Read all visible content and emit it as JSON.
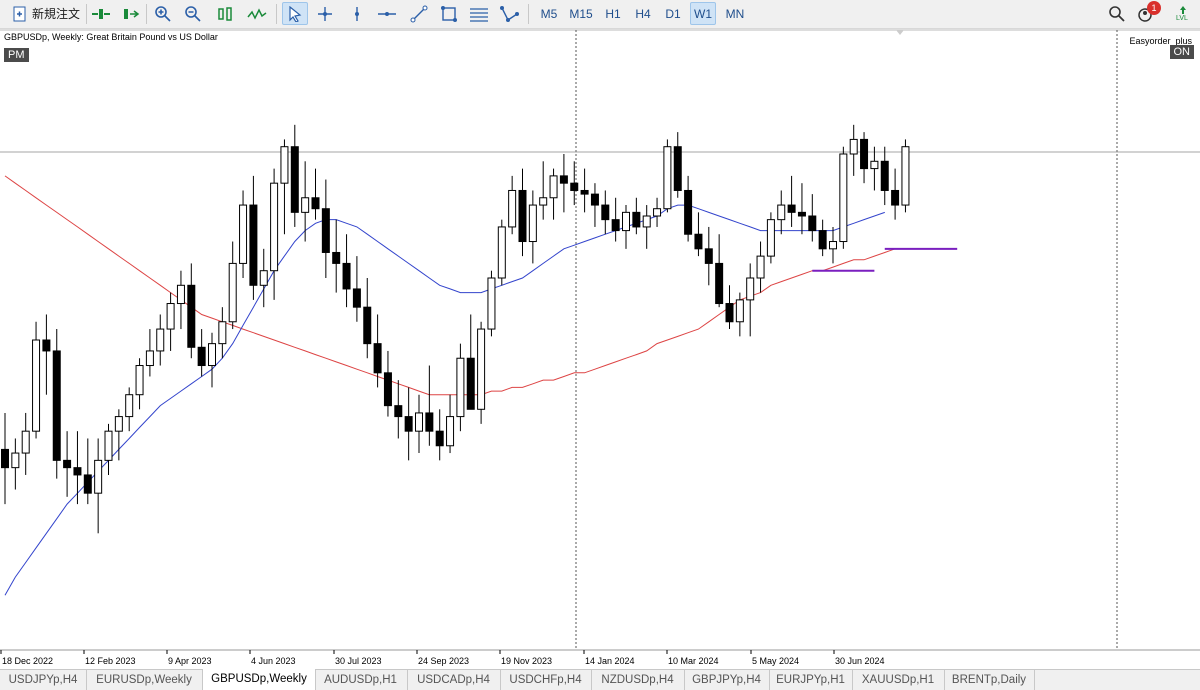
{
  "toolbar": {
    "new_order_label": "新規注文",
    "timeframes": [
      "M5",
      "M15",
      "H1",
      "H4",
      "D1",
      "W1",
      "MN"
    ],
    "active_timeframe": "W1",
    "notification_count": "1",
    "lvl_label": "LVL"
  },
  "chart": {
    "title": "GBPUSDp, Weekly:  Great Britain Pound vs US Dollar",
    "pm_badge": "PM",
    "ea_name": "Easyorder_plus",
    "ea_status": "ON",
    "x_labels": [
      "18 Dec 2022",
      "12 Feb 2023",
      "9 Apr 2023",
      "4 Jun 2023",
      "30 Jul 2023",
      "24 Sep 2023",
      "19 Nov 2023",
      "14 Jan 2024",
      "10 Mar 2024",
      "5 May 2024",
      "30 Jun 2024"
    ],
    "colors": {
      "bull": "#ffffff",
      "bear": "#000000",
      "ma_fast": "#3344cc",
      "ma_slow": "#dd4444",
      "hline": "#7a1fbf"
    },
    "candles": [
      {
        "o": -55,
        "h": -45,
        "l": -70,
        "c": -60
      },
      {
        "o": -60,
        "h": -52,
        "l": -66,
        "c": -56
      },
      {
        "o": -56,
        "h": -45,
        "l": -62,
        "c": -50
      },
      {
        "o": -50,
        "h": -20,
        "l": -52,
        "c": -25
      },
      {
        "o": -25,
        "h": -18,
        "l": -40,
        "c": -28
      },
      {
        "o": -28,
        "h": -22,
        "l": -63,
        "c": -58
      },
      {
        "o": -58,
        "h": -50,
        "l": -68,
        "c": -60
      },
      {
        "o": -60,
        "h": -50,
        "l": -70,
        "c": -62
      },
      {
        "o": -62,
        "h": -52,
        "l": -70,
        "c": -67
      },
      {
        "o": -67,
        "h": -52,
        "l": -78,
        "c": -58
      },
      {
        "o": -58,
        "h": -48,
        "l": -62,
        "c": -50
      },
      {
        "o": -50,
        "h": -44,
        "l": -58,
        "c": -46
      },
      {
        "o": -46,
        "h": -38,
        "l": -50,
        "c": -40
      },
      {
        "o": -40,
        "h": -30,
        "l": -44,
        "c": -32
      },
      {
        "o": -32,
        "h": -22,
        "l": -35,
        "c": -28
      },
      {
        "o": -28,
        "h": -18,
        "l": -32,
        "c": -22
      },
      {
        "o": -22,
        "h": -12,
        "l": -28,
        "c": -15
      },
      {
        "o": -15,
        "h": -6,
        "l": -22,
        "c": -10
      },
      {
        "o": -10,
        "h": -4,
        "l": -30,
        "c": -27
      },
      {
        "o": -27,
        "h": -22,
        "l": -35,
        "c": -32
      },
      {
        "o": -32,
        "h": -23,
        "l": -38,
        "c": -26
      },
      {
        "o": -26,
        "h": -16,
        "l": -30,
        "c": -20
      },
      {
        "o": -20,
        "h": 2,
        "l": -22,
        "c": -4
      },
      {
        "o": -4,
        "h": 16,
        "l": -8,
        "c": 12
      },
      {
        "o": 12,
        "h": 20,
        "l": -14,
        "c": -10
      },
      {
        "o": -10,
        "h": 0,
        "l": -16,
        "c": -6
      },
      {
        "o": -6,
        "h": 22,
        "l": -14,
        "c": 18
      },
      {
        "o": 18,
        "h": 30,
        "l": 4,
        "c": 28
      },
      {
        "o": 28,
        "h": 34,
        "l": 6,
        "c": 10
      },
      {
        "o": 10,
        "h": 24,
        "l": 2,
        "c": 14
      },
      {
        "o": 14,
        "h": 22,
        "l": 8,
        "c": 11
      },
      {
        "o": 11,
        "h": 19,
        "l": -8,
        "c": -1
      },
      {
        "o": -1,
        "h": 8,
        "l": -12,
        "c": -4
      },
      {
        "o": -4,
        "h": 4,
        "l": -16,
        "c": -11
      },
      {
        "o": -11,
        "h": -2,
        "l": -20,
        "c": -16
      },
      {
        "o": -16,
        "h": -8,
        "l": -30,
        "c": -26
      },
      {
        "o": -26,
        "h": -18,
        "l": -38,
        "c": -34
      },
      {
        "o": -34,
        "h": -28,
        "l": -46,
        "c": -43
      },
      {
        "o": -43,
        "h": -36,
        "l": -52,
        "c": -46
      },
      {
        "o": -46,
        "h": -38,
        "l": -58,
        "c": -50
      },
      {
        "o": -50,
        "h": -40,
        "l": -56,
        "c": -45
      },
      {
        "o": -45,
        "h": -32,
        "l": -54,
        "c": -50
      },
      {
        "o": -50,
        "h": -44,
        "l": -58,
        "c": -54
      },
      {
        "o": -54,
        "h": -40,
        "l": -56,
        "c": -46
      },
      {
        "o": -46,
        "h": -26,
        "l": -50,
        "c": -30
      },
      {
        "o": -30,
        "h": -18,
        "l": -38,
        "c": -44
      },
      {
        "o": -44,
        "h": -20,
        "l": -48,
        "c": -22
      },
      {
        "o": -22,
        "h": -6,
        "l": -24,
        "c": -8
      },
      {
        "o": -8,
        "h": 8,
        "l": -10,
        "c": 6
      },
      {
        "o": 6,
        "h": 20,
        "l": 4,
        "c": 16
      },
      {
        "o": 16,
        "h": 22,
        "l": -2,
        "c": 2
      },
      {
        "o": 2,
        "h": 16,
        "l": -4,
        "c": 12
      },
      {
        "o": 12,
        "h": 24,
        "l": 8,
        "c": 14
      },
      {
        "o": 14,
        "h": 22,
        "l": 8,
        "c": 20
      },
      {
        "o": 20,
        "h": 26,
        "l": 10,
        "c": 18
      },
      {
        "o": 18,
        "h": 24,
        "l": 12,
        "c": 16
      },
      {
        "o": 16,
        "h": 22,
        "l": 10,
        "c": 15
      },
      {
        "o": 15,
        "h": 18,
        "l": 6,
        "c": 12
      },
      {
        "o": 12,
        "h": 16,
        "l": 4,
        "c": 8
      },
      {
        "o": 8,
        "h": 14,
        "l": 2,
        "c": 5
      },
      {
        "o": 5,
        "h": 12,
        "l": 0,
        "c": 10
      },
      {
        "o": 10,
        "h": 14,
        "l": 4,
        "c": 6
      },
      {
        "o": 6,
        "h": 12,
        "l": 0,
        "c": 9
      },
      {
        "o": 9,
        "h": 14,
        "l": 6,
        "c": 11
      },
      {
        "o": 11,
        "h": 30,
        "l": 10,
        "c": 28
      },
      {
        "o": 28,
        "h": 32,
        "l": 14,
        "c": 16
      },
      {
        "o": 16,
        "h": 20,
        "l": 2,
        "c": 4
      },
      {
        "o": 4,
        "h": 10,
        "l": -2,
        "c": 0
      },
      {
        "o": 0,
        "h": 6,
        "l": -10,
        "c": -4
      },
      {
        "o": -4,
        "h": 4,
        "l": -16,
        "c": -15
      },
      {
        "o": -15,
        "h": -10,
        "l": -22,
        "c": -20
      },
      {
        "o": -20,
        "h": -12,
        "l": -24,
        "c": -14
      },
      {
        "o": -14,
        "h": -4,
        "l": -24,
        "c": -8
      },
      {
        "o": -8,
        "h": 2,
        "l": -12,
        "c": -2
      },
      {
        "o": -2,
        "h": 10,
        "l": -4,
        "c": 8
      },
      {
        "o": 8,
        "h": 16,
        "l": 4,
        "c": 12
      },
      {
        "o": 12,
        "h": 20,
        "l": 6,
        "c": 10
      },
      {
        "o": 10,
        "h": 18,
        "l": 4,
        "c": 9
      },
      {
        "o": 9,
        "h": 15,
        "l": 2,
        "c": 5
      },
      {
        "o": 5,
        "h": 8,
        "l": -2,
        "c": 0
      },
      {
        "o": 0,
        "h": 6,
        "l": -4,
        "c": 2
      },
      {
        "o": 2,
        "h": 28,
        "l": 0,
        "c": 26
      },
      {
        "o": 26,
        "h": 34,
        "l": 20,
        "c": 30
      },
      {
        "o": 30,
        "h": 32,
        "l": 18,
        "c": 22
      },
      {
        "o": 22,
        "h": 28,
        "l": 16,
        "c": 24
      },
      {
        "o": 24,
        "h": 28,
        "l": 12,
        "c": 16
      },
      {
        "o": 16,
        "h": 22,
        "l": 8,
        "c": 12
      },
      {
        "o": 12,
        "h": 30,
        "l": 10,
        "c": 28
      }
    ],
    "ma_fast": [
      -95,
      -90,
      -86,
      -82,
      -78,
      -74,
      -70,
      -67,
      -64,
      -61,
      -58,
      -55,
      -52,
      -49,
      -46,
      -43,
      -41,
      -39,
      -37,
      -35,
      -33,
      -30,
      -26,
      -21,
      -16,
      -11,
      -6,
      -2,
      2,
      5,
      7,
      8,
      8,
      7,
      6,
      4,
      2,
      0,
      -2,
      -4,
      -6,
      -8,
      -10,
      -11,
      -12,
      -12,
      -12,
      -11,
      -10,
      -9,
      -8,
      -6,
      -4,
      -2,
      0,
      1,
      2,
      3,
      4,
      5,
      6,
      7,
      8,
      9,
      11,
      12,
      12,
      11,
      10,
      9,
      8,
      7,
      6,
      5,
      5,
      5,
      5,
      5,
      5,
      5,
      5,
      6,
      7,
      8,
      9,
      10
    ],
    "ma_slow": [
      20,
      18,
      16,
      14,
      12,
      10,
      8,
      6,
      4,
      2,
      0,
      -2,
      -4,
      -6,
      -8,
      -10,
      -12,
      -14,
      -16,
      -18,
      -19,
      -20,
      -21,
      -22,
      -23,
      -24,
      -25,
      -26,
      -27,
      -28,
      -29,
      -30,
      -31,
      -32,
      -33,
      -34,
      -35,
      -36,
      -37,
      -38,
      -39,
      -40,
      -40,
      -40,
      -40,
      -40,
      -40,
      -39,
      -39,
      -38,
      -38,
      -37,
      -36,
      -36,
      -35,
      -34,
      -34,
      -33,
      -32,
      -31,
      -30,
      -29,
      -28,
      -26,
      -25,
      -24,
      -23,
      -22,
      -20,
      -18,
      -16,
      -14,
      -13,
      -12,
      -10,
      -9,
      -8,
      -7,
      -6,
      -6,
      -5,
      -4,
      -3,
      -3,
      -2,
      -1,
      0
    ],
    "support_lines": [
      {
        "i0": 78,
        "i1": 84,
        "y": -6
      },
      {
        "i0": 85,
        "i1": 92,
        "y": 0
      }
    ]
  },
  "tabs": [
    "USDJPYp,H4",
    "EURUSDp,Weekly",
    "GBPUSDp,Weekly",
    "AUDUSDp,H1",
    "USDCADp,H4",
    "USDCHFp,H4",
    "NZDUSDp,H4",
    "GBPJPYp,H4",
    "EURJPYp,H1",
    "XAUUSDp,H1",
    "BRENTp,Daily"
  ],
  "active_tab": "GBPUSDp,Weekly"
}
